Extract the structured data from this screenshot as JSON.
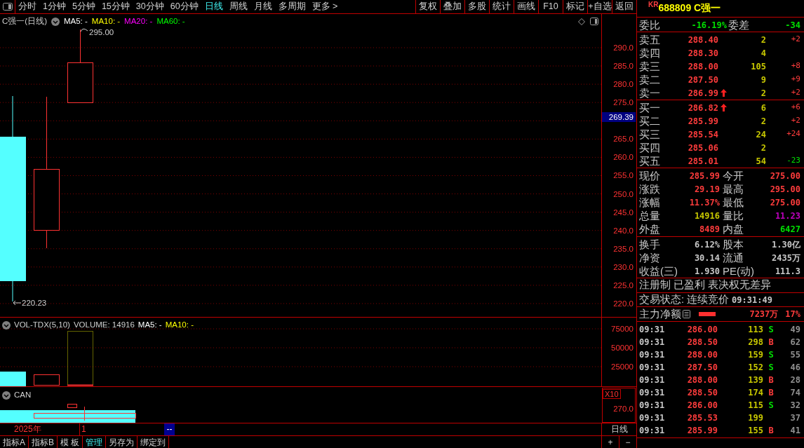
{
  "toolbar": {
    "periods": [
      {
        "label": "分时",
        "selected": false
      },
      {
        "label": "1分钟",
        "selected": false
      },
      {
        "label": "5分钟",
        "selected": false
      },
      {
        "label": "15分钟",
        "selected": false
      },
      {
        "label": "30分钟",
        "selected": false
      },
      {
        "label": "60分钟",
        "selected": false
      },
      {
        "label": "日线",
        "selected": true
      },
      {
        "label": "周线",
        "selected": false
      },
      {
        "label": "月线",
        "selected": false
      },
      {
        "label": "多周期",
        "selected": false
      },
      {
        "label": "更多 >",
        "selected": false
      }
    ],
    "actions": [
      "复权",
      "叠加",
      "多股",
      "统计",
      "画线",
      "F10",
      "标记",
      "+自选",
      "返回"
    ]
  },
  "main_chart": {
    "title": "C强一(日线)",
    "indicators": [
      {
        "label": "MA5: -",
        "color": "#ffffff"
      },
      {
        "label": "MA10: -",
        "color": "#ffff00"
      },
      {
        "label": "MA20: -",
        "color": "#ff00ff"
      },
      {
        "label": "MA60: -",
        "color": "#00ff00"
      }
    ],
    "high_label": "295.00",
    "low_label": "220.23",
    "current_price": "269.39",
    "upper_ticks": [
      "290.0",
      "285.0",
      "280.0",
      "275.0"
    ],
    "lower_ticks": [
      "265.0",
      "260.0",
      "255.0",
      "250.0",
      "245.0",
      "240.0",
      "235.0",
      "230.0",
      "225.0",
      "220.0"
    ]
  },
  "volume": {
    "title": "VOL-TDX(5,10)",
    "reading": "VOLUME: 14916",
    "indicators": [
      {
        "label": "MA5: -",
        "color": "#ffffff"
      },
      {
        "label": "MA10: -",
        "color": "#ffff00"
      }
    ],
    "ticks": [
      "75000",
      "50000",
      "25000"
    ],
    "scale": "X10"
  },
  "can_panel": {
    "title": "CAN",
    "ticks": [
      "270.0"
    ]
  },
  "date_bar": {
    "year": "2025年",
    "month": "1",
    "marker": "--",
    "period": "日线"
  },
  "bottom_tabs": [
    {
      "label": "指标A",
      "selected": false
    },
    {
      "label": "指标B",
      "selected": false
    },
    {
      "label": "模 板",
      "selected": false
    },
    {
      "label": "管理",
      "selected": true
    },
    {
      "label": "另存为",
      "selected": false
    },
    {
      "label": "绑定到",
      "selected": false
    }
  ],
  "zoom_buttons": [
    "+",
    "−"
  ],
  "quote": {
    "badge": "KR",
    "title": "688809 C强一",
    "weibi": {
      "label": "委比",
      "value": "-16.19%",
      "label2": "委差",
      "value2": "-34"
    },
    "asks": [
      {
        "label": "卖五",
        "price": "288.40",
        "volume": "2",
        "change": "+2",
        "color": "#ff3c3c",
        "arrow_up": false
      },
      {
        "label": "卖四",
        "price": "288.30",
        "volume": "4",
        "arrow_up": false
      },
      {
        "label": "卖三",
        "price": "288.00",
        "volume": "105",
        "change": "+8",
        "color": "#ff3c3c",
        "arrow_up": false
      },
      {
        "label": "卖二",
        "price": "287.50",
        "volume": "9",
        "change": "+9",
        "color": "#ff3c3c",
        "arrow_up": false
      },
      {
        "label": "卖一",
        "price": "286.99",
        "volume": "2",
        "change": "+2",
        "color": "#ff3c3c",
        "arrow_up": true
      }
    ],
    "bids": [
      {
        "label": "买一",
        "price": "286.82",
        "volume": "6",
        "change": "+6",
        "color": "#ff3c3c",
        "arrow_up": true
      },
      {
        "label": "买二",
        "price": "285.99",
        "volume": "2",
        "change": "+2",
        "color": "#ff3c3c",
        "arrow_up": false
      },
      {
        "label": "买三",
        "price": "285.54",
        "volume": "24",
        "change": "+24",
        "color": "#ff3c3c",
        "arrow_up": false
      },
      {
        "label": "买四",
        "price": "285.06",
        "volume": "2",
        "arrow_up": false
      },
      {
        "label": "买五",
        "price": "285.01",
        "volume": "54",
        "change": "-23",
        "color": "#00e000",
        "arrow_up": false
      }
    ],
    "stats": [
      {
        "cells": [
          {
            "label": "现价",
            "value": "285.99",
            "color": "#ff3c3c"
          },
          {
            "label": "今开",
            "value": "275.00",
            "color": "#ff3c3c"
          }
        ]
      },
      {
        "cells": [
          {
            "label": "涨跌",
            "value": "29.19",
            "color": "#ff3c3c"
          },
          {
            "label": "最高",
            "value": "295.00",
            "color": "#ff3c3c"
          }
        ]
      },
      {
        "cells": [
          {
            "label": "涨幅",
            "value": "11.37%",
            "color": "#ff3c3c"
          },
          {
            "label": "最低",
            "value": "275.00",
            "color": "#ff3c3c"
          }
        ]
      },
      {
        "cells": [
          {
            "label": "总量",
            "value": "14916",
            "color": "#c8c800"
          },
          {
            "label": "量比",
            "value": "11.23",
            "color": "#c000c0"
          }
        ]
      },
      {
        "cells": [
          {
            "label": "外盘",
            "value": "8489",
            "color": "#ff3c3c"
          },
          {
            "label": "内盘",
            "value": "6427",
            "color": "#00e000"
          }
        ]
      }
    ],
    "fundamentals": [
      {
        "cells": [
          {
            "label": "换手",
            "value": "6.12%"
          },
          {
            "label": "股本",
            "value": "1.30亿"
          }
        ]
      },
      {
        "cells": [
          {
            "label": "净资",
            "value": "30.14"
          },
          {
            "label": "流通",
            "value": "2435万"
          }
        ]
      },
      {
        "cells": [
          {
            "label": "收益(三)",
            "value": "1.930"
          },
          {
            "label": "PE(动)",
            "value": "111.3"
          }
        ]
      }
    ],
    "notice": "注册制 已盈利 表决权无差异",
    "status": {
      "label": "交易状态: 连续竞价",
      "time": "09:31:49"
    },
    "main_flow": {
      "label": "主力净额",
      "value": "7237万",
      "percent": "17%"
    },
    "trades": [
      {
        "time": "09:31",
        "price": "286.00",
        "volume": "113",
        "side": "S",
        "color": "#00e000",
        "count": "49"
      },
      {
        "time": "09:31",
        "price": "288.50",
        "volume": "298",
        "side": "B",
        "color": "#ff3c3c",
        "count": "62"
      },
      {
        "time": "09:31",
        "price": "288.00",
        "volume": "159",
        "side": "S",
        "color": "#00e000",
        "count": "55"
      },
      {
        "time": "09:31",
        "price": "287.50",
        "volume": "152",
        "side": "S",
        "color": "#00e000",
        "count": "46"
      },
      {
        "time": "09:31",
        "price": "288.00",
        "volume": "139",
        "side": "B",
        "color": "#ff3c3c",
        "count": "28"
      },
      {
        "time": "09:31",
        "price": "288.50",
        "volume": "174",
        "side": "B",
        "color": "#ff3c3c",
        "count": "74"
      },
      {
        "time": "09:31",
        "price": "286.00",
        "volume": "115",
        "side": "S",
        "color": "#00e000",
        "count": "32"
      },
      {
        "time": "09:31",
        "price": "285.53",
        "volume": "199",
        "count": "37"
      },
      {
        "time": "09:31",
        "price": "285.99",
        "volume": "155",
        "side": "B",
        "color": "#ff3c3c",
        "count": "41"
      }
    ]
  }
}
